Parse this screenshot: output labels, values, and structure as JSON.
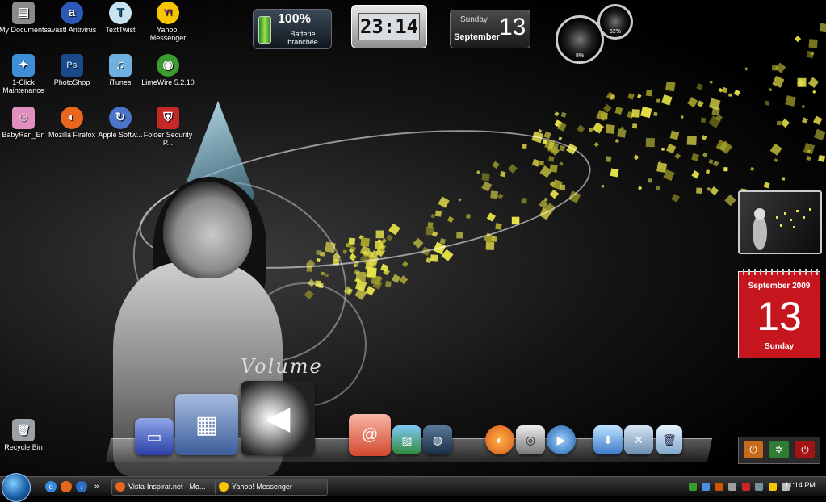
{
  "desktop_icons": [
    {
      "label": "My Documents",
      "glyph": "▤",
      "bg": "#8a8a8a"
    },
    {
      "label": "avast! Antivirus",
      "glyph": "a",
      "bg": "#2c59b8"
    },
    {
      "label": "TextTwist",
      "glyph": "T",
      "bg": "#c9e4f0"
    },
    {
      "label": "Yahoo! Messenger",
      "glyph": "Y!",
      "bg": "#6a1b9a"
    },
    {
      "label": "1-Click Maintenance",
      "glyph": "✦",
      "bg": "#3f8ed8"
    },
    {
      "label": "PhotoShop",
      "glyph": "Ps",
      "bg": "#1a4a8a"
    },
    {
      "label": "iTunes",
      "glyph": "♫",
      "bg": "#6fb0e0"
    },
    {
      "label": "LimeWire 5.2.10",
      "glyph": "◉",
      "bg": "#3c9b2f"
    },
    {
      "label": "BabyRan_En",
      "glyph": "☺",
      "bg": "#e08fbf"
    },
    {
      "label": "Mozilla Firefox",
      "glyph": "◐",
      "bg": "#e8661e"
    },
    {
      "label": "Apple Softw...",
      "glyph": "↻",
      "bg": "#4a74c9"
    },
    {
      "label": "Folder Security P...",
      "glyph": "⛨",
      "bg": "#c62828"
    },
    {
      "label": "Recycle Bin",
      "glyph": "🗑",
      "bg": "#9aa2a8"
    }
  ],
  "gadgets": {
    "battery": {
      "percent": "100%",
      "status": "Batterie branchée"
    },
    "clock": {
      "time": "23:14"
    },
    "date": {
      "weekday": "Sunday",
      "month": "September",
      "day": "13"
    },
    "cpu_meter": {
      "cpu": "8%",
      "ram": "62%"
    },
    "calendar": {
      "month_year": "September 2009",
      "day": "13",
      "weekday": "Sunday"
    }
  },
  "dock": {
    "volume_word": "Volume",
    "items": [
      "Computer",
      "Control Panel",
      "Volume",
      "Mail",
      "Photos",
      "Globe",
      "Firefox",
      "Webcam",
      "Media Player",
      "Downloads",
      "Tools",
      "Recycle"
    ]
  },
  "power_gadget": {
    "buttons": [
      "power-on",
      "sleep",
      "shutdown"
    ]
  },
  "taskbar": {
    "quick_launch_more": "»",
    "windows": [
      {
        "title": "Vista-Inspirat.net - Mo..."
      },
      {
        "title": "Yahoo! Messenger"
      }
    ],
    "clock": "11:14 PM"
  }
}
